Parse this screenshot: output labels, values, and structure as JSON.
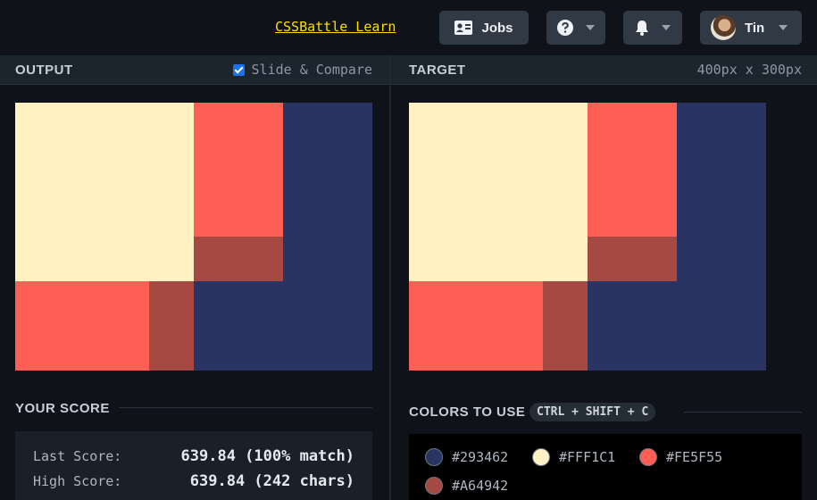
{
  "topbar": {
    "learn_link": "CSSBattle Learn",
    "jobs_label": "Jobs",
    "help_icon": "question-circle-icon",
    "bell_icon": "bell-icon",
    "user_name": "Tin"
  },
  "output": {
    "title": "OUTPUT",
    "slide_compare_label": "Slide & Compare",
    "slide_compare_checked": true
  },
  "target": {
    "title": "TARGET",
    "dimensions": "400px x 300px"
  },
  "score": {
    "title": "YOUR SCORE",
    "last_label": "Last Score:",
    "last_value": "639.84 (100% match)",
    "high_label": "High Score:",
    "high_value": "639.84 (242 chars)"
  },
  "colors": {
    "title": "COLORS TO USE",
    "shortcut": "CTRL + SHIFT + C",
    "items": [
      {
        "hex": "#293462",
        "label": "#293462"
      },
      {
        "hex": "#FFF1C1",
        "label": "#FFF1C1"
      },
      {
        "hex": "#FE5F55",
        "label": "#FE5F55"
      },
      {
        "hex": "#A64942",
        "label": "#A64942"
      }
    ]
  },
  "accent_colors": {
    "link": "#FFDF00",
    "button_bg": "#303944",
    "panel_header": "#1C242D"
  }
}
